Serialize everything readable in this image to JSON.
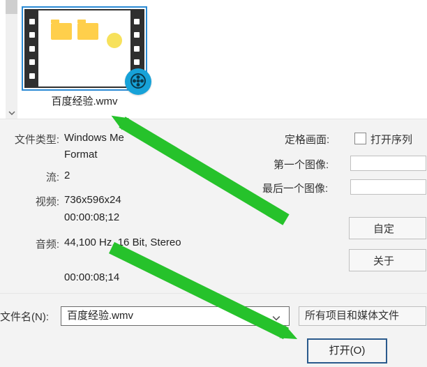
{
  "file": {
    "selected_name": "百度经验.wmv"
  },
  "info": {
    "file_type_label": "文件类型:",
    "file_type_value_line1": "Windows Me",
    "file_type_value_line2": "Format",
    "streams_label": "流:",
    "streams_value": "2",
    "video_label": "视频:",
    "video_value": "736x596x24",
    "video_duration": "00:00:08;12",
    "audio_label": "音频:",
    "audio_value": "44,100 Hz, 16 Bit, Stereo",
    "audio_duration": "00:00:08;14"
  },
  "right_panel": {
    "freeze_frame_label": "定格画面:",
    "open_sequence_label": "打开序列",
    "first_image_label": "第一个图像:",
    "last_image_label": "最后一个图像:",
    "custom_button": "自定",
    "about_button": "关于"
  },
  "bottom": {
    "filename_label": "文件名(N):",
    "filename_value": "百度经验.wmv",
    "filter_label": "所有项目和媒体文件",
    "open_button": "打开(O)"
  }
}
